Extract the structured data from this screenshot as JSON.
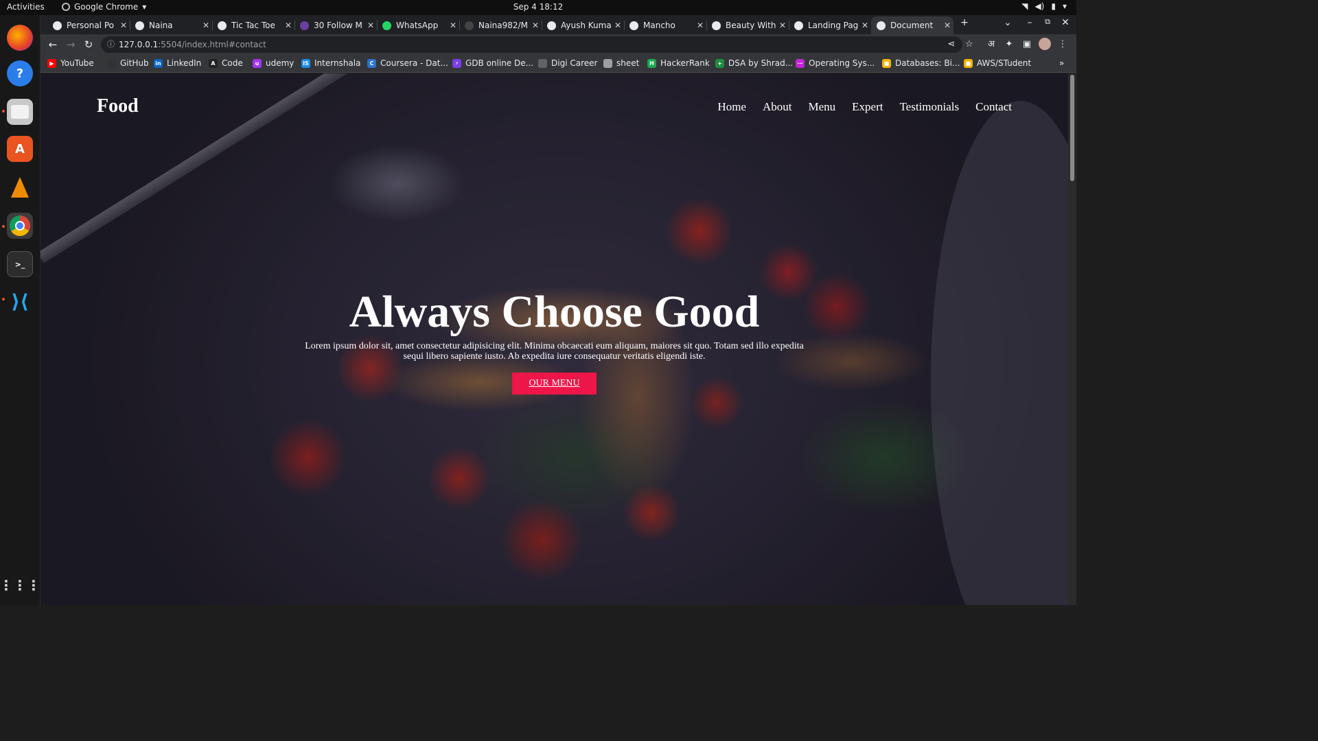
{
  "system": {
    "activities": "Activities",
    "app_name": "Google Chrome",
    "clock": "Sep 4  18:12"
  },
  "tabs": [
    {
      "title": "Personal Po",
      "fav_color": "#e8eaed"
    },
    {
      "title": "Naina",
      "fav_color": "#e8eaed"
    },
    {
      "title": "Tic Tac Toe",
      "fav_color": "#e8eaed"
    },
    {
      "title": "30 Follow M",
      "fav_color": "#6a3fa0"
    },
    {
      "title": "WhatsApp",
      "fav_color": "#25d366"
    },
    {
      "title": "Naina982/M",
      "fav_color": "#444444"
    },
    {
      "title": "Ayush Kuma",
      "fav_color": "#e8eaed"
    },
    {
      "title": "Mancho",
      "fav_color": "#e8eaed"
    },
    {
      "title": "Beauty With",
      "fav_color": "#e8eaed"
    },
    {
      "title": "Landing Pag",
      "fav_color": "#e8eaed"
    },
    {
      "title": "Document",
      "fav_color": "#e8eaed",
      "active": true
    }
  ],
  "toolbar": {
    "url_host": "127.0.0.1",
    "url_rest": ":5504/index.html#contact",
    "profile_initial": "अ"
  },
  "bookmarks": [
    {
      "label": "YouTube",
      "color": "#ff0000",
      "glyph": "▶"
    },
    {
      "label": "GitHub",
      "color": "#333333",
      "glyph": ""
    },
    {
      "label": "LinkedIn",
      "color": "#0a66c2",
      "glyph": "in"
    },
    {
      "label": "Code",
      "color": "#222222",
      "glyph": "A"
    },
    {
      "label": "udemy",
      "color": "#a435f0",
      "glyph": "u"
    },
    {
      "label": "Internshala",
      "color": "#1c8ee6",
      "glyph": "IS"
    },
    {
      "label": "Coursera - Dat...",
      "color": "#2a73cc",
      "glyph": "C"
    },
    {
      "label": "GDB online De...",
      "color": "#7b3fe4",
      "glyph": "⚡"
    },
    {
      "label": "Digi Career",
      "color": "#5f6368",
      "glyph": ""
    },
    {
      "label": "sheet",
      "color": "#9aa0a6",
      "glyph": ""
    },
    {
      "label": "HackerRank",
      "color": "#1ba94c",
      "glyph": "H"
    },
    {
      "label": "DSA by Shrad...",
      "color": "#1e8e3e",
      "glyph": "+"
    },
    {
      "label": "Operating Sys...",
      "color": "#c026d3",
      "glyph": "⋯"
    },
    {
      "label": "Databases: Bi...",
      "color": "#f4b400",
      "glyph": "■"
    },
    {
      "label": "AWS/STudent",
      "color": "#f4b400",
      "glyph": "■"
    }
  ],
  "site": {
    "logo": "Food",
    "nav": [
      "Home",
      "About",
      "Menu",
      "Expert",
      "Testimonials",
      "Contact"
    ],
    "hero_title": "Always Choose Good",
    "hero_text": "Lorem ipsum dolor sit, amet consectetur adipisicing elit. Minima obcaecati eum aliquam, maiores sit quo. Totam sed illo expedita sequi libero sapiente iusto. Ab expedita iure consequatur veritatis eligendi iste.",
    "cta_label": "OUR MENU",
    "accent": "#ee1549"
  }
}
